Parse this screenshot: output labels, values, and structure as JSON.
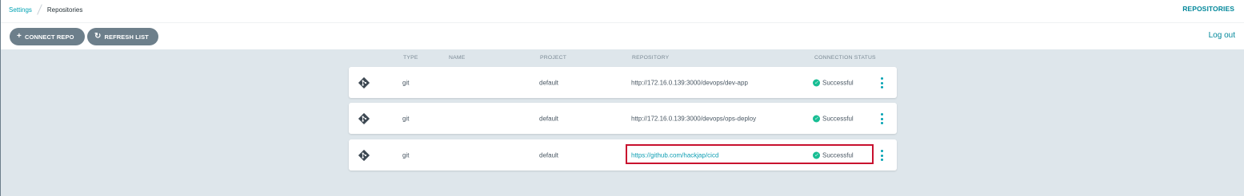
{
  "breadcrumb": {
    "settings": "Settings",
    "current": "Repositories"
  },
  "header": {
    "title_right": "REPOSITORIES",
    "logout": "Log out"
  },
  "toolbar": {
    "connect": {
      "icon": "+",
      "label": "CONNECT REPO"
    },
    "refresh": {
      "icon": "↻",
      "label": "REFRESH LIST"
    }
  },
  "columns": [
    "TYPE",
    "NAME",
    "PROJECT",
    "REPOSITORY",
    "CONNECTION STATUS"
  ],
  "rows": [
    {
      "type": "git",
      "name": "",
      "project": "default",
      "repository": "http://172.16.0.139:3000/devops/dev-app",
      "status": "Successful",
      "repo_is_link": false
    },
    {
      "type": "git",
      "name": "",
      "project": "default",
      "repository": "http://172.16.0.139:3000/devops/ops-deploy",
      "status": "Successful",
      "repo_is_link": false
    },
    {
      "type": "git",
      "name": "",
      "project": "default",
      "repository": "https://github.com/hackjap/cicd",
      "status": "Successful",
      "repo_is_link": true
    }
  ],
  "icons": {
    "row": "git-icon",
    "status": "check-circle-icon",
    "menu": "kebab-menu-icon"
  },
  "colors": {
    "accent": "#00a2b3",
    "success": "#18be94",
    "highlight": "#c8102e",
    "button": "#6d7f8b"
  }
}
